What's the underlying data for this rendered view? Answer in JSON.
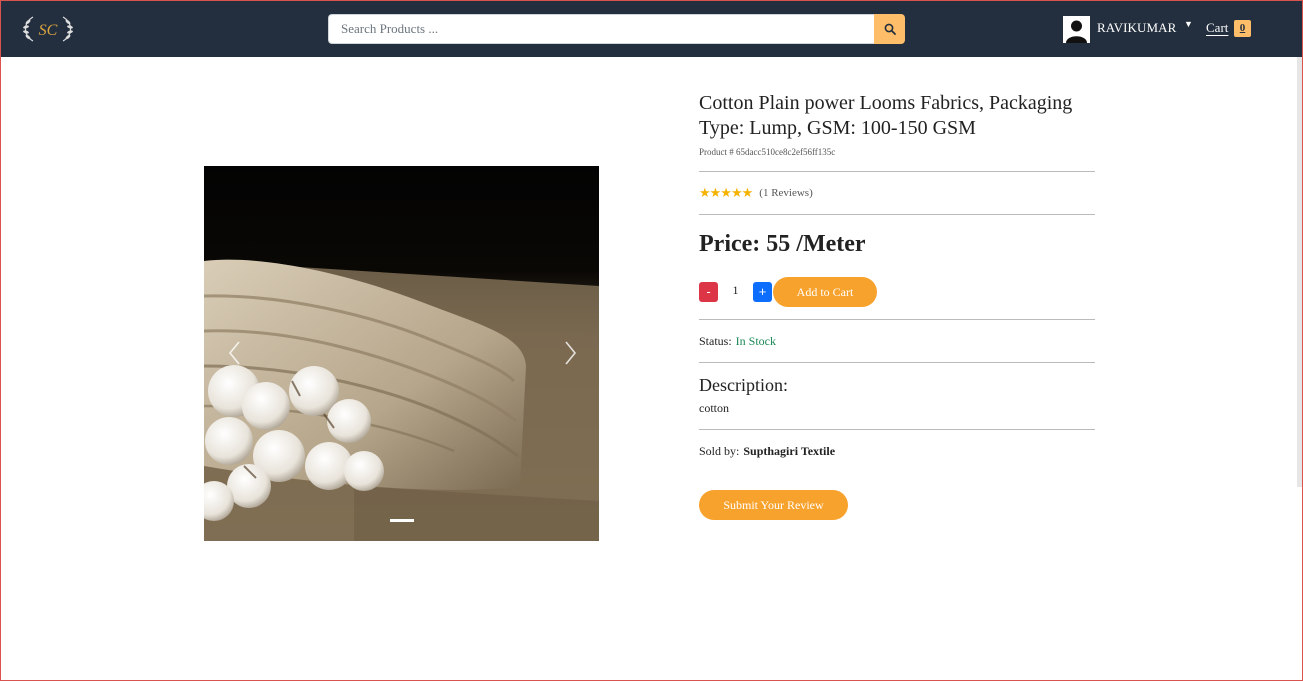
{
  "header": {
    "logo_text": "SC",
    "search_placeholder": "Search Products ...",
    "username": "RAVIKUMAR",
    "cart_label": "Cart",
    "cart_count": "0",
    "colors": {
      "nav_bg": "#232f3e",
      "accent": "#febd69"
    }
  },
  "product": {
    "title": "Cotton Plain power Looms Fabrics, Packaging Type: Lump, GSM: 100-150 GSM",
    "product_id": "Product # 65dacc510ce8c2ef56ff135c",
    "rating_stars": "★★★★★",
    "rating_value": 5,
    "reviews": "(1 Reviews)",
    "price": "Price: 55 /Meter",
    "qty_minus": "-",
    "qty_value": "1",
    "qty_plus": "+",
    "add_to_cart": "Add to Cart",
    "status_label": "Status:",
    "status_value": "In Stock",
    "description_heading": "Description:",
    "description_text": "cotton",
    "sold_by_label": "Sold by:",
    "sold_by_value": "Supthagiri Textile",
    "submit_review": "Submit Your Review",
    "colors": {
      "button": "#f7a22d",
      "minus": "#dc3545",
      "plus": "#0d6efd",
      "in_stock": "#198754"
    }
  },
  "carousel": {
    "prev_icon": "chevron-left-icon",
    "next_icon": "chevron-right-icon",
    "slides": 1,
    "active_slide": 1
  }
}
